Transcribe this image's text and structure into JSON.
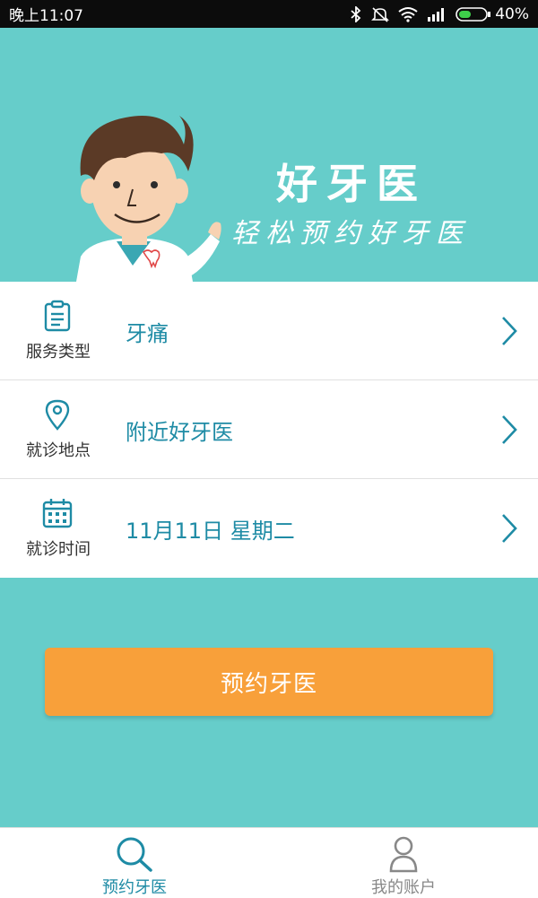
{
  "status_bar": {
    "time": "晚上11:07",
    "battery": "40%"
  },
  "hero": {
    "title": "好牙医",
    "subtitle": "轻松预约好牙医"
  },
  "form": {
    "rows": [
      {
        "label": "服务类型",
        "value": "牙痛",
        "icon": "clipboard-icon"
      },
      {
        "label": "就诊地点",
        "value": "附近好牙医",
        "icon": "location-pin-icon"
      },
      {
        "label": "就诊时间",
        "value": "11月11日 星期二",
        "icon": "calendar-icon"
      }
    ]
  },
  "book_button": {
    "label": "预约牙医"
  },
  "tab_bar": {
    "tabs": [
      {
        "label": "预约牙医",
        "icon": "search-icon",
        "active": true
      },
      {
        "label": "我的账户",
        "icon": "user-icon",
        "active": false
      }
    ]
  },
  "colors": {
    "background": "#66cdca",
    "accent": "#1e8ba5",
    "button": "#f8a03a"
  }
}
